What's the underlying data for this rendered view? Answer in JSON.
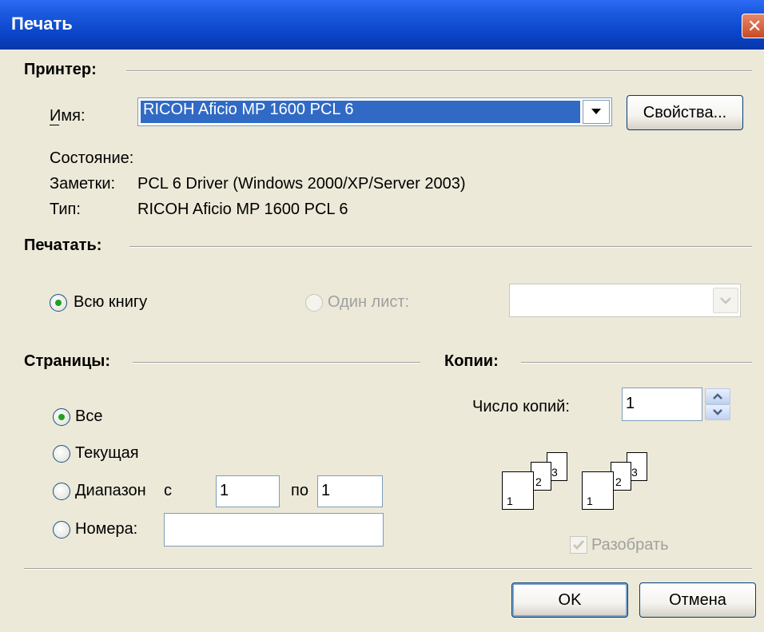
{
  "window": {
    "title": "Печать"
  },
  "printer": {
    "section_label": "Принтер:",
    "name_label": "Имя:",
    "name_value": "RICOH Aficio MP 1600 PCL 6",
    "properties_button": "Свойства...",
    "status_label": "Состояние:",
    "status_value": "",
    "notes_label": "Заметки:",
    "notes_value": "PCL 6 Driver (Windows 2000/XP/Server 2003)",
    "type_label": "Тип:",
    "type_value": "RICOH Aficio MP 1600 PCL 6"
  },
  "print_what": {
    "section_label": "Печатать:",
    "whole_book": "Всю книгу",
    "one_sheet": "Один лист:",
    "sheet_value": ""
  },
  "pages": {
    "section_label": "Страницы:",
    "all": "Все",
    "current": "Текущая",
    "range": "Диапазон",
    "from_label": "с",
    "from_value": "1",
    "to_label": "по",
    "to_value": "1",
    "numbers": "Номера:",
    "numbers_value": "",
    "selected": "all"
  },
  "copies": {
    "section_label": "Копии:",
    "count_label": "Число копий:",
    "count_value": "1",
    "collate": "Разобрать",
    "collate_checked": true,
    "stack_pages": [
      "1",
      "2",
      "3"
    ]
  },
  "buttons": {
    "ok": "OK",
    "cancel": "Отмена"
  }
}
